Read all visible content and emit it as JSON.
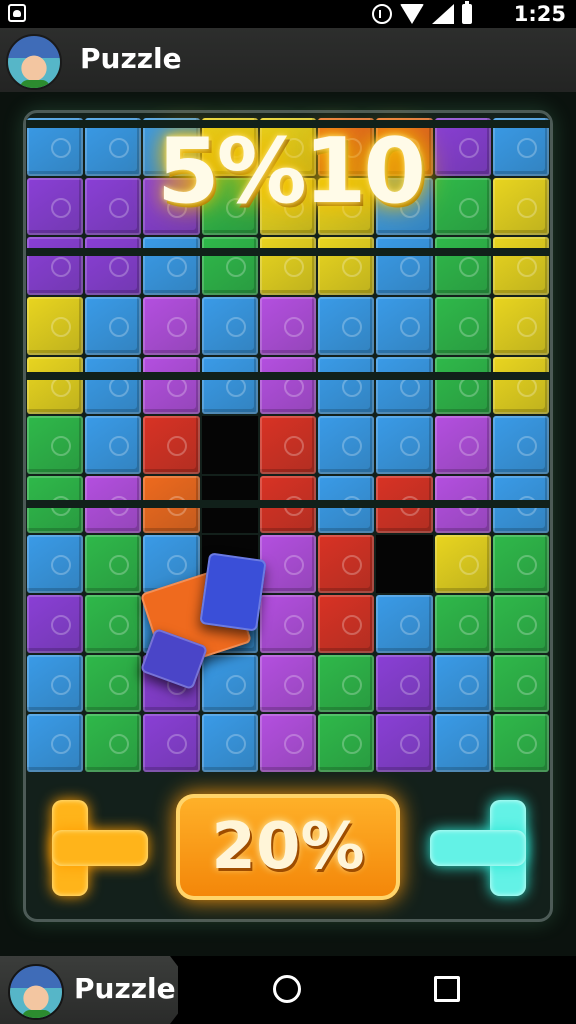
{
  "status_bar": {
    "time": "1:25"
  },
  "header": {
    "app_title": "Puzzle"
  },
  "game": {
    "score_display": "5%10",
    "progress_display": "20%"
  },
  "nav_bar": {
    "app_title": "Puzzle"
  },
  "colors": {
    "blue": "#3a9be8",
    "purple": "#8a3fd6",
    "green": "#2fb94a",
    "orange": "#ef6a1e",
    "red": "#d93224",
    "yellow": "#e9d51f",
    "magenta": "#b44fe0",
    "left_piece_glow": "#ffb41a",
    "right_piece_glow": "#63f2e6"
  }
}
